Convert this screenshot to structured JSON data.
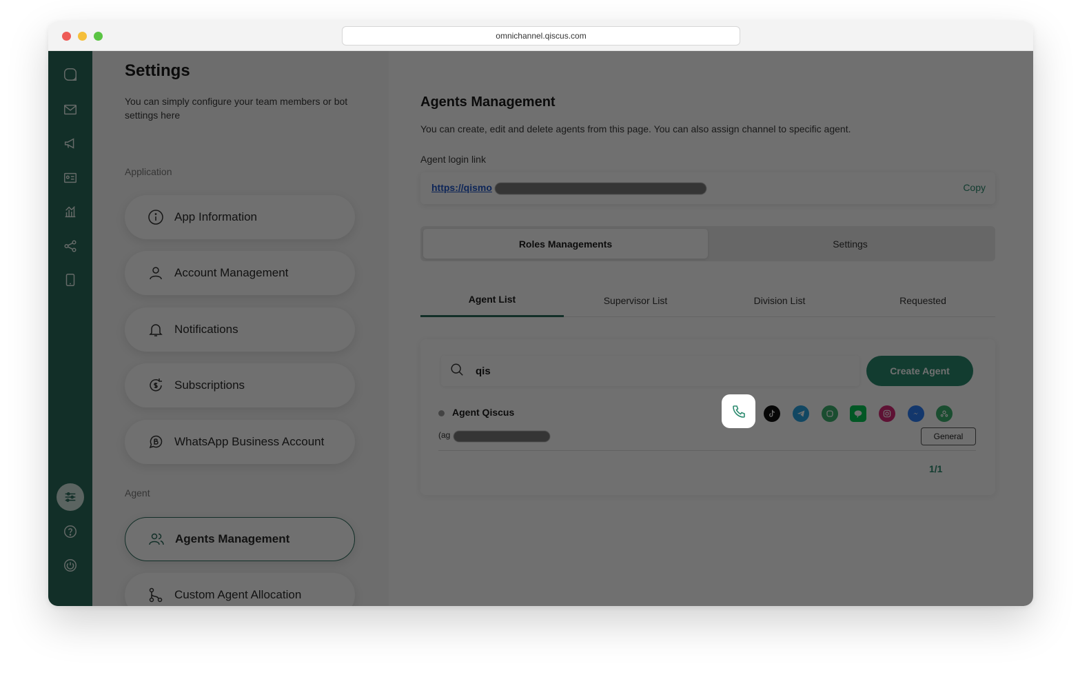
{
  "browser": {
    "url": "omnichannel.qiscus.com"
  },
  "settings": {
    "title": "Settings",
    "subtitle": "You can simply configure your team members or bot settings here",
    "sections": {
      "application_label": "Application",
      "agent_label": "Agent"
    },
    "application_items": [
      {
        "label": "App Information",
        "icon": "info-icon"
      },
      {
        "label": "Account Management",
        "icon": "user-icon"
      },
      {
        "label": "Notifications",
        "icon": "bell-icon"
      },
      {
        "label": "Subscriptions",
        "icon": "subscription-icon"
      },
      {
        "label": "WhatsApp Business Account",
        "icon": "whatsapp-business-icon"
      }
    ],
    "agent_items": [
      {
        "label": "Agents Management",
        "icon": "users-icon",
        "active": true
      },
      {
        "label": "Custom Agent Allocation",
        "icon": "allocation-icon"
      }
    ]
  },
  "main": {
    "title": "Agents Management",
    "description": "You can create, edit and delete agents from this page. You can also assign channel to specific agent.",
    "login_link_label": "Agent login link",
    "login_link_visible": "https://qismo",
    "copy_label": "Copy",
    "segments": [
      "Roles Managements",
      "Settings"
    ],
    "tabs": [
      "Agent List",
      "Supervisor List",
      "Division List",
      "Requested"
    ],
    "search": {
      "value": "qis",
      "placeholder": ""
    },
    "create_agent_label": "Create Agent",
    "agent": {
      "name": "Agent Qiscus",
      "email_visible": "(ag",
      "division": "General",
      "channels": [
        "phone-icon",
        "whatsapp-icon",
        "tiktok-icon",
        "telegram-icon",
        "qiscus-icon",
        "line-icon",
        "instagram-icon",
        "messenger-icon",
        "custom-channel-icon"
      ]
    },
    "pagination": "1/1"
  },
  "colors": {
    "brand": "#2b6b5b",
    "accent": "#2b8a6e",
    "overlay": "rgba(0,0,0,0.56)"
  }
}
